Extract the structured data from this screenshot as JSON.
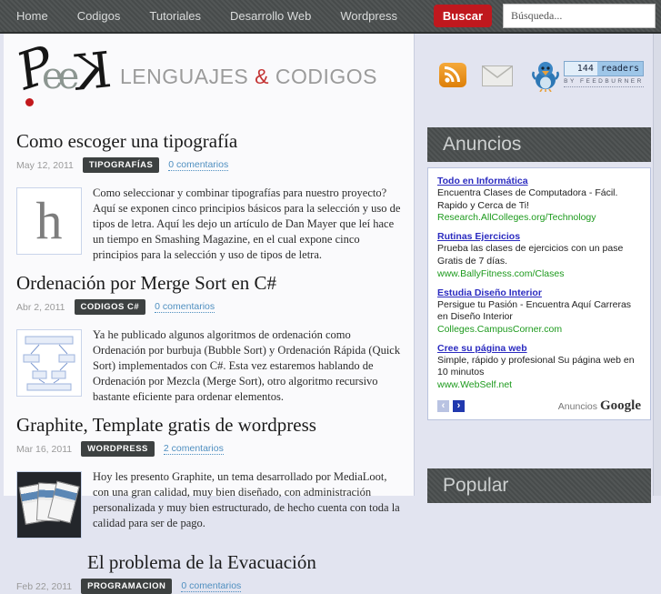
{
  "nav": {
    "items": [
      "Home",
      "Codigos",
      "Tutoriales",
      "Desarrollo Web",
      "Wordpress"
    ],
    "search_button": "Buscar",
    "search_placeholder": "Búsqueda..."
  },
  "header": {
    "logo": {
      "p": "P",
      "ee": "ee",
      "k": "K"
    },
    "tagline": {
      "word1": "LENGUAJES",
      "amp": "&",
      "word2": "CODIGOS"
    },
    "feedburner": {
      "count": "144",
      "label": "readers",
      "byline": "BY FEEDBURNER"
    }
  },
  "posts": [
    {
      "title": "Como escoger una tipografía",
      "date": "May 12, 2011",
      "category": "TIPOGRAFÍAS",
      "comments": "0 comentarios",
      "thumb_letter": "h",
      "excerpt": "Como seleccionar y combinar tipografías para nuestro proyecto? Aquí se exponen cinco principios básicos para la selección y uso de tipos de letra. Aquí les dejo un artículo de Dan Mayer que leí hace un tiempo en Smashing Magazine, en el cual expone cinco principios para la selección y uso de tipos de letra."
    },
    {
      "title": "Ordenación por Merge Sort en C#",
      "date": "Abr 2, 2011",
      "category": "CODIGOS C#",
      "comments": "0 comentarios",
      "excerpt": "Ya he publicado algunos algoritmos de ordenación como Ordenación por burbuja (Bubble Sort) y Ordenación Rápida (Quick Sort) implementados con C#. Esta vez estaremos hablando de Ordenación por Mezcla (Merge Sort), otro algoritmo recursivo bastante eficiente para ordenar elementos."
    },
    {
      "title": "Graphite, Template gratis de wordpress",
      "date": "Mar 16, 2011",
      "category": "WORDPRESS",
      "comments": "2 comentarios",
      "excerpt": "Hoy les presento Graphite, un tema desarrollado por MediaLoot, con una gran calidad, muy bien diseñado, con administración personalizada y muy bien estructurado, de hecho cuenta con toda la calidad para ser de pago."
    },
    {
      "title": "El problema de la Evacuación",
      "date": "Feb 22, 2011",
      "category": "PROGRAMACION",
      "comments": "0 comentarios"
    }
  ],
  "sidebar": {
    "anuncios_title": "Anuncios",
    "ads": [
      {
        "title": "Todo en Informática",
        "text": "Encuentra Clases de Computadora - Fácil. Rapido y Cerca de Ti!",
        "url": "Research.AllColleges.org/Technology"
      },
      {
        "title": "Rutinas Ejercicios",
        "text": "Prueba las clases de ejercicios con un pase Gratis de 7 días.",
        "url": "www.BallyFitness.com/Clases"
      },
      {
        "title": "Estudia Diseño Interior",
        "text": "Persigue tu Pasión - Encuentra Aquí Carreras en Diseño Interior",
        "url": "Colleges.CampusCorner.com"
      },
      {
        "title": "Cree su página web",
        "text": "Simple, rápido y profesional Su página web en 10 minutos",
        "url": "www.WebSelf.net"
      }
    ],
    "ads_footer": {
      "prev": "‹",
      "next": "›",
      "brand_left": "Anuncios",
      "brand_right": "Google"
    },
    "popular_title": "Popular"
  },
  "colors": {
    "accent_red": "#c0181e",
    "comments_blue": "#4f8fc0",
    "ad_title_blue": "#2b2bc0",
    "ad_url_green": "#1d9a1d",
    "nav_bg": "#4b4f4f",
    "page_bg": "#e2e4f0"
  }
}
